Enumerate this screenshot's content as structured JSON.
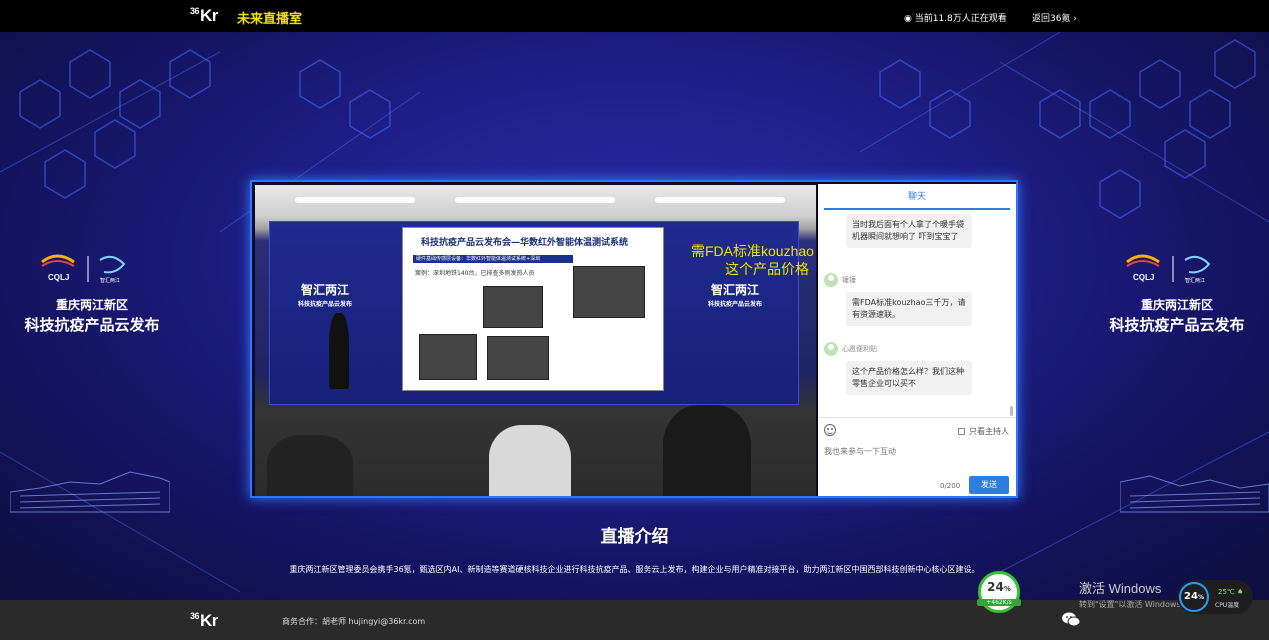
{
  "header": {
    "logo": "36Kr",
    "logo_sup": "36",
    "logo_main": "Kr",
    "title": "未来直播室",
    "viewer_count": "当前11.8万人正在观看",
    "back_link": "返回36氪"
  },
  "side_brand": {
    "logo_left": "CQLJ",
    "logo_right": "智汇两江",
    "line1": "重庆两江新区",
    "line2": "科技抗疫产品云发布"
  },
  "video": {
    "screen_left_title": "智汇两江",
    "screen_left_sub": "科技抗疫产品云发布",
    "screen_right_title": "智汇两江",
    "screen_right_sub": "科技抗疫产品云发布",
    "slide_title": "科技抗疫产品云发布会—华数红外智能体温测试系统",
    "slide_band": "硬件基础传感层设备：华数红外智能体温测试系统+深圳",
    "slide_case": "案例：深圳地铁140台，已排查多例发热人员",
    "overlay_line1": "需FDA标准kouzhao",
    "overlay_line2": "这个产品价格"
  },
  "chat": {
    "tab_label": "聊天",
    "messages": [
      {
        "user": "",
        "text": "当时我后面有个人拿了个暖手袋 机器瞬间就想响了 吓到宝宝了"
      },
      {
        "user": "锤锤",
        "text": "需FDA标准kouzhao三千万，请有资源速联。"
      },
      {
        "user": "心愿便利贴",
        "text": "这个产品价格怎么样？我们这种零售企业可以买不"
      }
    ],
    "host_only_label": "只看主持人",
    "input_placeholder": "我也来参与一下互动",
    "char_count": "0/200",
    "send_label": "发送"
  },
  "intro": {
    "title": "直播介绍",
    "description": "重庆两江新区管理委员会携手36氪，甄选区内AI、新制造等赛道硬核科技企业进行科技抗疫产品、服务云上发布，构建企业与用户精准对接平台，助力两江新区中国西部科技创新中心核心区建设。"
  },
  "footer": {
    "logo": "36Kr",
    "contact": "商务合作：胡老师 hujingyi@36kr.com",
    "wechat_icon": "wechat-icon"
  },
  "overlays": {
    "activate_title": "激活 Windows",
    "activate_sub": "转到\"设置\"以激活 Windows。",
    "speed_percent": "24",
    "speed_rate": "+462K/s",
    "cpu_percent": "24",
    "cpu_temp": "25℃",
    "cpu_label": "CPU温度"
  },
  "colors": {
    "title_yellow": "#f2e100",
    "accent_blue": "#2f7de1",
    "background": "#201f8c"
  }
}
